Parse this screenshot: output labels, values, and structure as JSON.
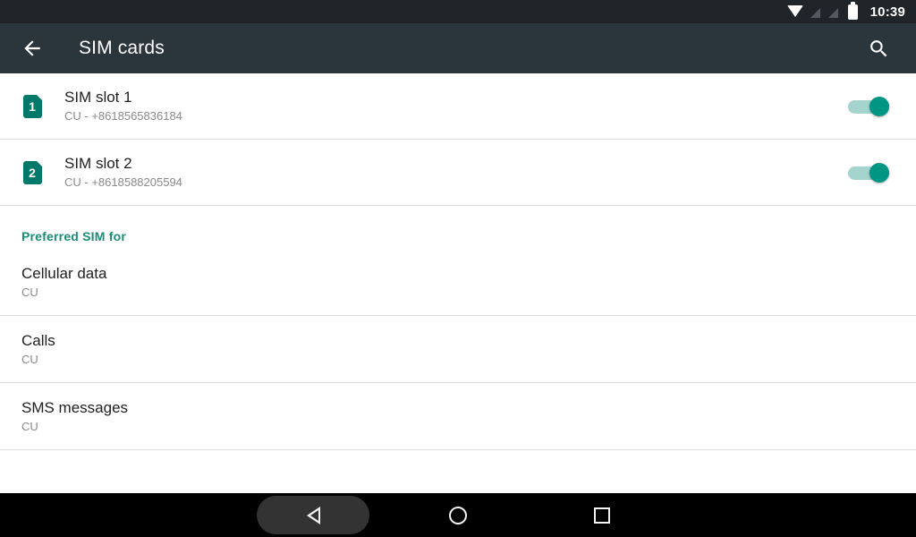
{
  "status_bar": {
    "time": "10:39",
    "icons": [
      "wifi-icon",
      "signal-sim1-icon",
      "signal-sim2-icon",
      "battery-icon"
    ]
  },
  "app_bar": {
    "back_icon": "arrow-back-icon",
    "title": "SIM cards",
    "search_icon": "search-icon"
  },
  "sim_slots": [
    {
      "badge": "1",
      "title": "SIM slot 1",
      "subtitle": "CU - +8618565836184",
      "enabled": "on"
    },
    {
      "badge": "2",
      "title": "SIM slot 2",
      "subtitle": "CU - +8618588205594",
      "enabled": "on"
    }
  ],
  "section": {
    "header": "Preferred SIM for",
    "rows": [
      {
        "title": "Cellular data",
        "subtitle": "CU"
      },
      {
        "title": "Calls",
        "subtitle": "CU"
      },
      {
        "title": "SMS messages",
        "subtitle": "CU"
      }
    ]
  },
  "nav_bar": {
    "back_label": "back-icon",
    "home_label": "home-icon",
    "recents_label": "recents-icon"
  },
  "colors": {
    "status_bar_bg": "#1f2529",
    "app_bar_bg": "#2b353c",
    "accent_teal": "#1a8d77",
    "badge_teal": "#00796b",
    "toggle_on": "#009683",
    "toggle_track": "#a5d3cd",
    "divider": "#dadada",
    "nav_bar_bg": "#000000"
  }
}
